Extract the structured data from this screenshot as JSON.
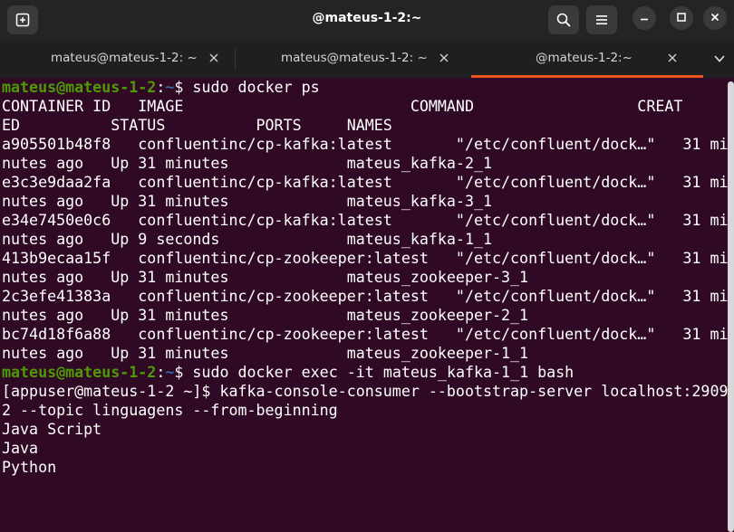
{
  "window": {
    "title": "@mateus-1-2:~"
  },
  "tabs": [
    {
      "label": "mateus@mateus-1-2: ~",
      "active": false
    },
    {
      "label": "mateus@mateus-1-2: ~",
      "active": false
    },
    {
      "label": "@mateus-1-2:~",
      "active": true
    }
  ],
  "icons": {
    "new_tab": "new-tab-icon",
    "search": "search-icon",
    "menu": "hamburger-menu-icon",
    "minimize": "minimize-icon",
    "maximize": "maximize-icon",
    "close": "close-icon",
    "tab_close": "close-icon",
    "tab_dropdown": "chevron-down-icon"
  },
  "colors": {
    "terminal_bg": "#300a24",
    "prompt_user": "#4e9a06",
    "prompt_path": "#3465a4",
    "active_tab_accent": "#e95420"
  },
  "terminal": {
    "prompt1": {
      "user": "mateus@mateus-1-2",
      "colon": ":",
      "path": "~",
      "rest": "$ sudo docker ps"
    },
    "output1": [
      "CONTAINER ID   IMAGE                         COMMAND                  CREAT",
      "ED          STATUS          PORTS     NAMES",
      "a905501b48f8   confluentinc/cp-kafka:latest       \"/etc/confluent/dock…\"   31 mi",
      "nutes ago   Up 31 minutes             mateus_kafka-2_1",
      "e3c3e9daa2fa   confluentinc/cp-kafka:latest       \"/etc/confluent/dock…\"   31 mi",
      "nutes ago   Up 31 minutes             mateus_kafka-3_1",
      "e34e7450e0c6   confluentinc/cp-kafka:latest       \"/etc/confluent/dock…\"   31 mi",
      "nutes ago   Up 9 seconds              mateus_kafka-1_1",
      "413b9ecaa15f   confluentinc/cp-zookeeper:latest   \"/etc/confluent/dock…\"   31 mi",
      "nutes ago   Up 31 minutes             mateus_zookeeper-3_1",
      "2c3efe41383a   confluentinc/cp-zookeeper:latest   \"/etc/confluent/dock…\"   31 mi",
      "nutes ago   Up 31 minutes             mateus_zookeeper-2_1",
      "bc74d18f6a88   confluentinc/cp-zookeeper:latest   \"/etc/confluent/dock…\"   31 mi",
      "nutes ago   Up 31 minutes             mateus_zookeeper-1_1"
    ],
    "prompt2": {
      "user": "mateus@mateus-1-2",
      "colon": ":",
      "path": "~",
      "rest": "$ sudo docker exec -it mateus_kafka-1_1 bash"
    },
    "output2": [
      "[appuser@mateus-1-2 ~]$ kafka-console-consumer --bootstrap-server localhost:2909",
      "2 --topic linguagens --from-beginning",
      "Java Script",
      "Java",
      "Python"
    ]
  }
}
